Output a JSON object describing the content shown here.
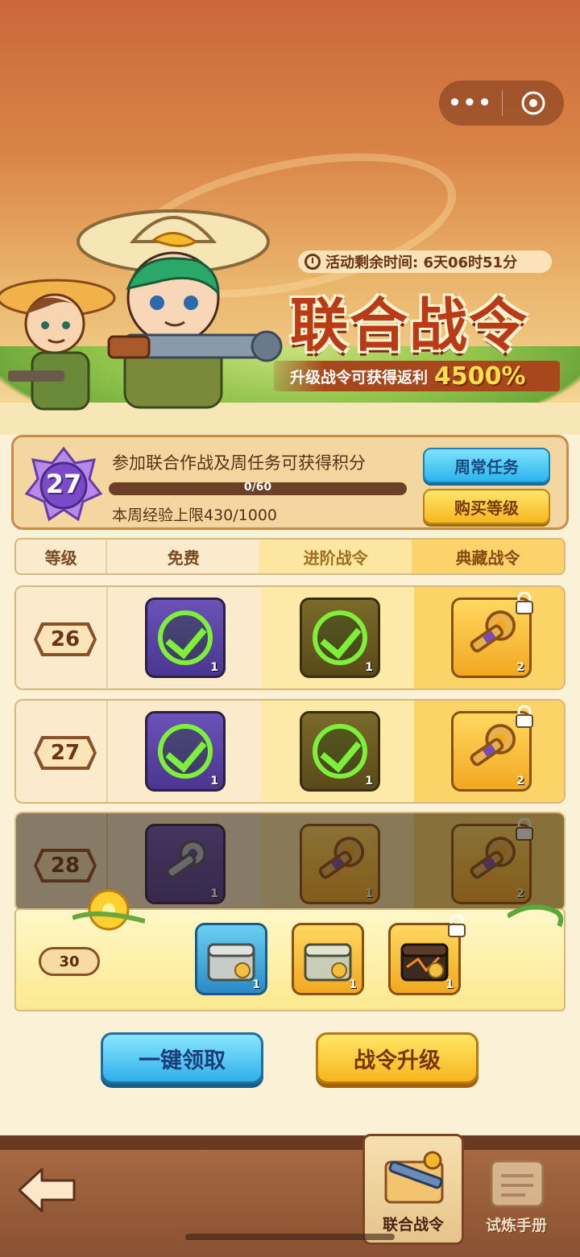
{
  "capsule": {
    "more_label": "•••",
    "close_icon": "target-circle-icon"
  },
  "banner": {
    "timer_label": "活动剩余时间: 6天06时51分",
    "title": "联合战令",
    "promo_text": "升级战令可获得返利",
    "promo_percent": "4500%"
  },
  "info": {
    "level": "27",
    "description": "参加联合作战及周任务可获得积分",
    "progress_text": "0/60",
    "progress_value": 0,
    "weekly_limit": "本周经验上限430/1000",
    "weekly_tasks_button": "周常任务",
    "buy_level_button": "购买等级"
  },
  "table": {
    "headers": [
      "等级",
      "免费",
      "进阶战令",
      "典藏战令"
    ],
    "rows": [
      {
        "level": "26",
        "free": {
          "claimed": true,
          "count": "1"
        },
        "advanced": {
          "claimed": true,
          "count": "1"
        },
        "collector": {
          "icon": "key-icon",
          "count": "2",
          "locked": true
        }
      },
      {
        "level": "27",
        "free": {
          "claimed": true,
          "count": "1"
        },
        "advanced": {
          "claimed": true,
          "count": "1"
        },
        "collector": {
          "icon": "key-icon",
          "count": "2",
          "locked": true
        }
      },
      {
        "level": "28",
        "free": {
          "claimed": false,
          "icon": "silver-key-icon",
          "count": "1"
        },
        "advanced": {
          "claimed": false,
          "icon": "key-icon",
          "count": "1"
        },
        "collector": {
          "icon": "key-icon",
          "count": "2",
          "locked": true
        }
      }
    ],
    "milestone": {
      "level": "30",
      "free": {
        "icon": "silver-chest-icon",
        "count": "1"
      },
      "advanced": {
        "icon": "stone-chest-icon",
        "count": "1"
      },
      "collector": {
        "icon": "dark-chest-icon",
        "count": "1",
        "locked": true
      }
    }
  },
  "actions": {
    "claim_all": "一键领取",
    "upgrade": "战令升级"
  },
  "bottom_nav": {
    "tabs": [
      {
        "label": "联合战令",
        "active": true,
        "icon": "rifle-icon"
      },
      {
        "label": "试炼手册",
        "active": false,
        "icon": "scroll-icon"
      }
    ],
    "back_icon": "back-arrow-icon"
  },
  "colors": {
    "accent_red": "#b83a16",
    "claim_green": "#7ef03a",
    "button_blue": "#2bb4ea",
    "button_yellow": "#f5b820"
  }
}
